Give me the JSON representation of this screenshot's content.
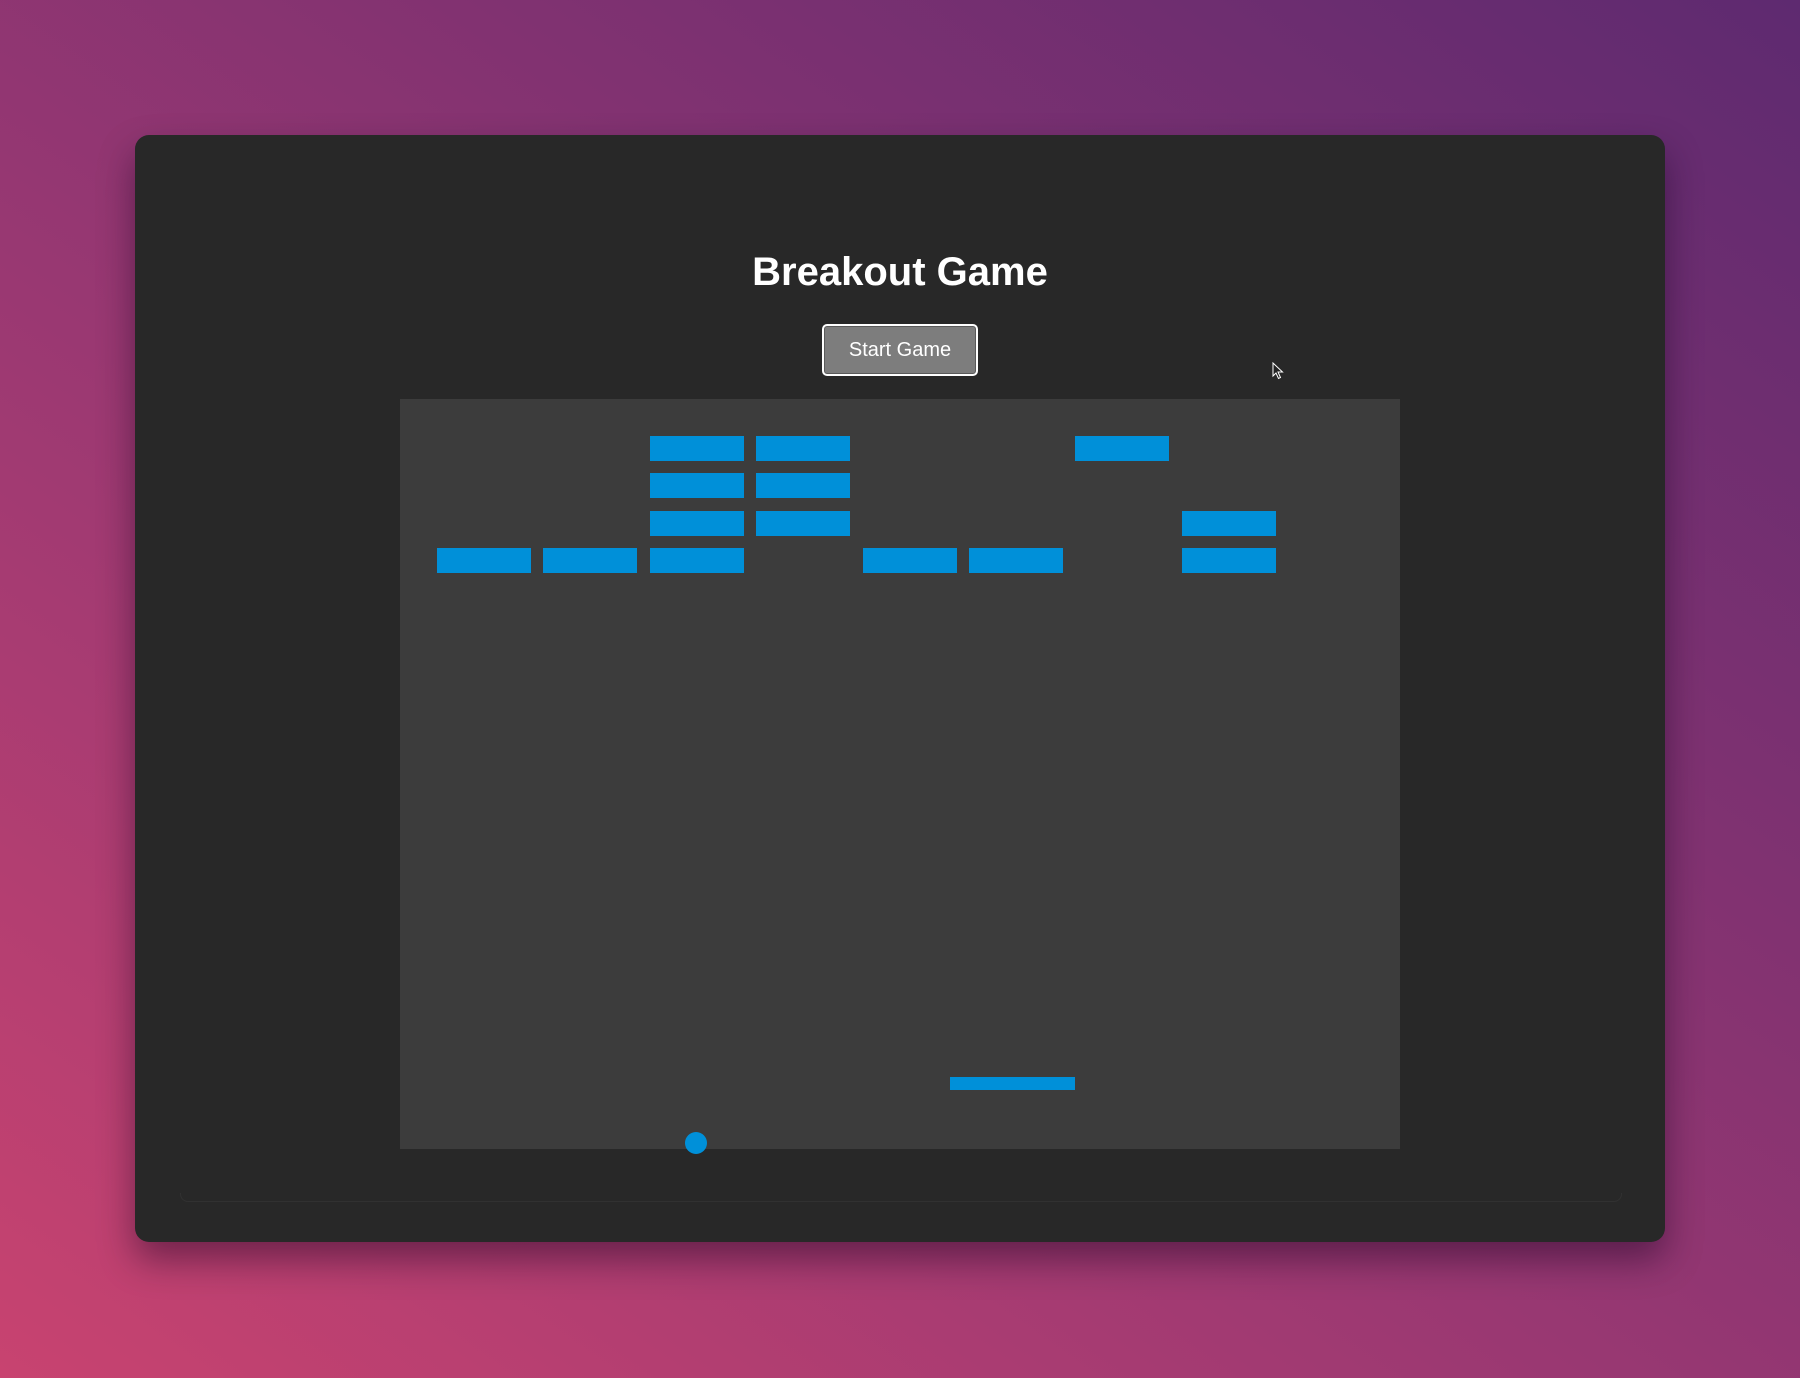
{
  "game": {
    "title": "Breakout Game",
    "start_button_label": "Start Game"
  },
  "colors": {
    "background_start": "#c84370",
    "background_end": "#5e2a70",
    "window": "#282828",
    "canvas": "#3c3c3c",
    "brick": "#0090d9",
    "paddle": "#0090d9",
    "ball": "#0090d9",
    "button": "#7d7d7d"
  },
  "board": {
    "columns": 9,
    "rows": 4,
    "bricks": [
      {
        "row": 0,
        "col": 2
      },
      {
        "row": 0,
        "col": 3
      },
      {
        "row": 0,
        "col": 6
      },
      {
        "row": 1,
        "col": 2
      },
      {
        "row": 1,
        "col": 3
      },
      {
        "row": 2,
        "col": 2
      },
      {
        "row": 2,
        "col": 3
      },
      {
        "row": 2,
        "col": 7
      },
      {
        "row": 3,
        "col": 0
      },
      {
        "row": 3,
        "col": 1
      },
      {
        "row": 3,
        "col": 2
      },
      {
        "row": 3,
        "col": 4
      },
      {
        "row": 3,
        "col": 5
      },
      {
        "row": 3,
        "col": 7
      }
    ]
  }
}
